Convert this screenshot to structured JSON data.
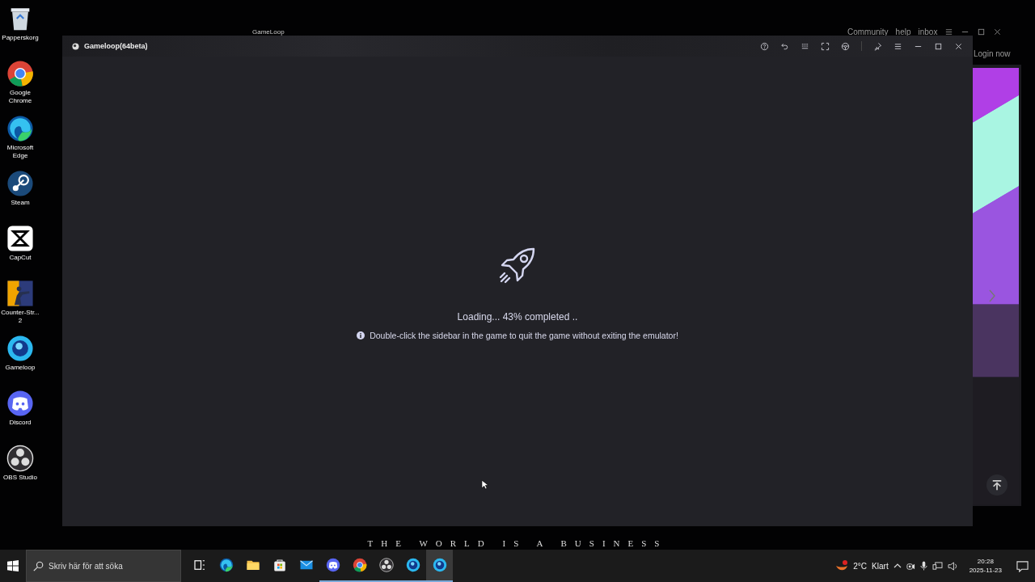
{
  "desktop_icons": [
    {
      "kind": "recycle-bin",
      "label": "Papperskorg"
    },
    {
      "kind": "chrome",
      "label": "Google Chrome"
    },
    {
      "kind": "edge",
      "label": "Microsoft Edge"
    },
    {
      "kind": "steam",
      "label": "Steam"
    },
    {
      "kind": "capcut",
      "label": "CapCut"
    },
    {
      "kind": "shooter",
      "label": "Counter-Str... 2"
    },
    {
      "kind": "gameloop",
      "label": "Gameloop"
    },
    {
      "kind": "discord",
      "label": "Discord"
    },
    {
      "kind": "obs",
      "label": "OBS Studio"
    }
  ],
  "background_app": {
    "logo": "GameLoop",
    "nav": [
      "Community",
      "help",
      "inbox"
    ],
    "login": "Login now",
    "tagline": "THE WORLD IS A BUSINESS"
  },
  "emulator": {
    "title": "Gameloop(64beta)",
    "toolbar": [
      {
        "kind": "help"
      },
      {
        "kind": "undo"
      },
      {
        "kind": "keys"
      },
      {
        "kind": "fullscreen"
      },
      {
        "kind": "wheel"
      },
      {
        "kind": "pin"
      },
      {
        "kind": "menu"
      },
      {
        "kind": "minimize"
      },
      {
        "kind": "maximize"
      },
      {
        "kind": "close"
      }
    ],
    "loading": "Loading... 43% completed ..",
    "tip": "Double-click the sidebar in the game to quit the game without exiting the emulator!"
  },
  "taskbar": {
    "search": {
      "placeholder": "Skriv här för att söka"
    },
    "apps": [
      {
        "kind": "taskview",
        "running": false,
        "selected": false
      },
      {
        "kind": "edge",
        "running": false,
        "selected": false
      },
      {
        "kind": "folder",
        "running": false,
        "selected": false
      },
      {
        "kind": "store",
        "running": false,
        "selected": false
      },
      {
        "kind": "mail",
        "running": false,
        "selected": false
      },
      {
        "kind": "discord",
        "running": true,
        "selected": false
      },
      {
        "kind": "chrome",
        "running": true,
        "selected": false
      },
      {
        "kind": "obs",
        "running": true,
        "selected": false
      },
      {
        "kind": "gameloop",
        "running": true,
        "selected": false
      },
      {
        "kind": "gameloop",
        "running": true,
        "selected": true
      }
    ],
    "weather": {
      "temperature": "2°C",
      "condition": "Klart"
    },
    "clock": {
      "time": "20:28",
      "date": "2025-11-23"
    }
  }
}
